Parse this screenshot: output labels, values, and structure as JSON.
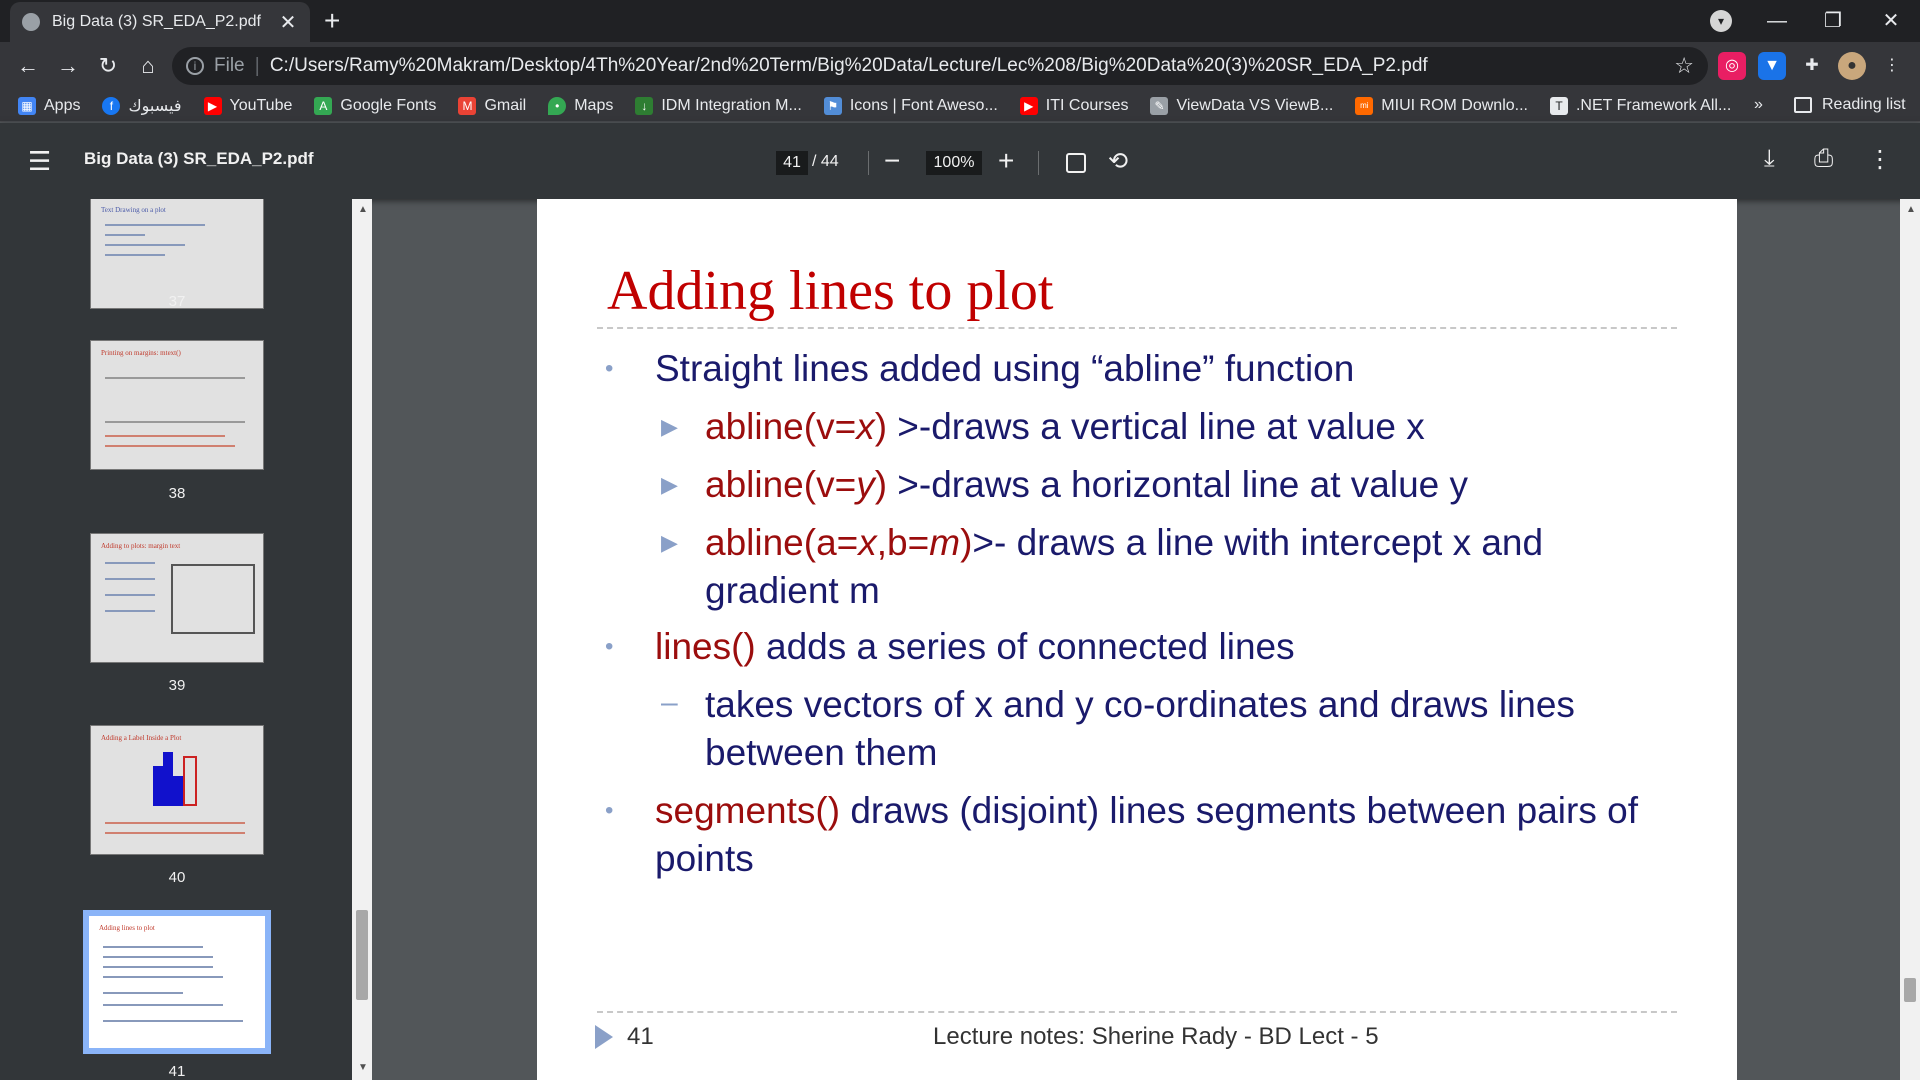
{
  "browser": {
    "tab_title": "Big Data (3) SR_EDA_P2.pdf",
    "url_scheme": "File",
    "url": "C:/Users/Ramy%20Makram/Desktop/4Th%20Year/2nd%20Term/Big%20Data/Lecture/Lec%208/Big%20Data%20(3)%20SR_EDA_P2.pdf"
  },
  "bookmarks": [
    {
      "label": "Apps",
      "color": "#4285f4"
    },
    {
      "label": "فيسبوك",
      "color": "#1877f2"
    },
    {
      "label": "YouTube",
      "color": "#ff0000"
    },
    {
      "label": "Google Fonts",
      "color": "#34a853"
    },
    {
      "label": "Gmail",
      "color": "#ea4335"
    },
    {
      "label": "Maps",
      "color": "#fbbc04"
    },
    {
      "label": "IDM Integration M...",
      "color": "#2e7d32"
    },
    {
      "label": "Icons | Font Aweso...",
      "color": "#528dd7"
    },
    {
      "label": "ITI Courses",
      "color": "#ff0000"
    },
    {
      "label": "ViewData VS ViewB...",
      "color": "#9aa0a6"
    },
    {
      "label": "MIUI ROM Downlo...",
      "color": "#ff6900"
    },
    {
      "label": ".NET Framework All...",
      "color": "#e8eaed"
    }
  ],
  "bookmarks_more": "»",
  "reading_list": "Reading list",
  "viewer": {
    "doc_title": "Big Data (3) SR_EDA_P2.pdf",
    "page_current": "41",
    "page_total": "/ 44",
    "zoom": "100%"
  },
  "thumbnails": [
    {
      "num": "37",
      "title": "Text Drawing on a plot"
    },
    {
      "num": "38",
      "title": "Printing on margins: mtext()"
    },
    {
      "num": "39",
      "title": "Adding to plots: margin text"
    },
    {
      "num": "40",
      "title": "Adding a Label Inside a Plot"
    },
    {
      "num": "41",
      "title": "Adding lines to plot"
    }
  ],
  "slide": {
    "title": "Adding lines to plot",
    "b1": "Straight lines added using “abline” function",
    "b1_1_code": "abline(v=",
    "b1_1_var": "x",
    "b1_1_close": ")",
    "b1_1_rest": " >-draws a vertical line at value x",
    "b1_2_code": "abline(v=",
    "b1_2_var": "y",
    "b1_2_close": ")",
    "b1_2_rest": " >-draws a horizontal line at value y",
    "b1_3_code": "abline(a=",
    "b1_3_var1": "x",
    "b1_3_mid": ",b=",
    "b1_3_var2": "m",
    "b1_3_close": ")",
    "b1_3_rest": ">- draws a line with intercept x and gradient m",
    "b2_code": "lines()",
    "b2_rest": " adds a series of connected lines",
    "b2_1": "takes vectors of x and y co-ordinates and draws lines between them",
    "b3_code": "segments()",
    "b3_rest": " draws (disjoint) lines segments between pairs of points",
    "footer_page": "41",
    "footer_text": "Lecture notes: Sherine Rady - BD Lect - 5"
  }
}
